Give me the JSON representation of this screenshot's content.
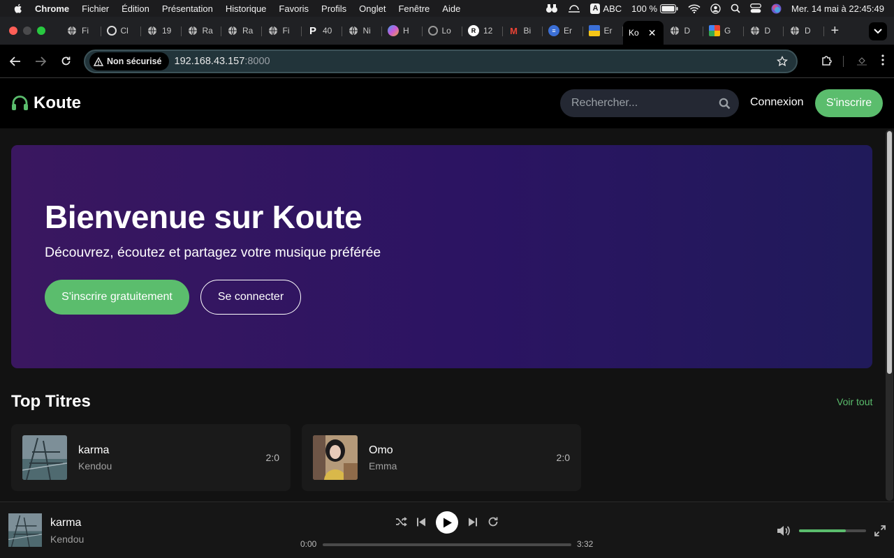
{
  "menubar": {
    "app": "Chrome",
    "items": [
      "Fichier",
      "Édition",
      "Présentation",
      "Historique",
      "Favoris",
      "Profils",
      "Onglet",
      "Fenêtre",
      "Aide"
    ],
    "input_source": "ABC",
    "battery": "100 %",
    "datetime": "Mer. 14 mai à  22:45:49"
  },
  "tabs": [
    {
      "label": "Fi",
      "icon": "globe-icon"
    },
    {
      "label": "Cl",
      "icon": "openai-icon"
    },
    {
      "label": "19",
      "icon": "globe-icon"
    },
    {
      "label": "Ra",
      "icon": "globe-icon"
    },
    {
      "label": "Ra",
      "icon": "globe-icon"
    },
    {
      "label": "Fi",
      "icon": "globe-icon"
    },
    {
      "label": "40",
      "icon": "p-icon"
    },
    {
      "label": "Ni",
      "icon": "globe-icon"
    },
    {
      "label": "H",
      "icon": "copilot-icon"
    },
    {
      "label": "Lo",
      "icon": "globe-icon"
    },
    {
      "label": "12",
      "icon": "r-icon"
    },
    {
      "label": "Bi",
      "icon": "gmail-icon"
    },
    {
      "label": "Er",
      "icon": "list-icon"
    },
    {
      "label": "Er",
      "icon": "flag-icon"
    },
    {
      "label": "Ko",
      "icon": "",
      "active": true
    },
    {
      "label": "D",
      "icon": "globe-icon"
    },
    {
      "label": "G",
      "icon": "gcloud-icon"
    },
    {
      "label": "D",
      "icon": "globe-icon"
    },
    {
      "label": "D",
      "icon": "globe-icon"
    }
  ],
  "address": {
    "security_chip": "Non sécurisé",
    "host": "192.168.43.157",
    "port": ":8000"
  },
  "site": {
    "logo": "Koute",
    "search_placeholder": "Rechercher...",
    "login": "Connexion",
    "signup": "S'inscrire"
  },
  "hero": {
    "title": "Bienvenue sur Koute",
    "subtitle": "Découvrez, écoutez et partagez votre musique préférée",
    "primary_cta": "S'inscrire gratuitement",
    "secondary_cta": "Se connecter"
  },
  "top_tracks": {
    "title": "Top Titres",
    "see_all": "Voir tout",
    "items": [
      {
        "title": "karma",
        "artist": "Kendou",
        "duration": "2:0"
      },
      {
        "title": "Omo",
        "artist": "Emma",
        "duration": "2:0"
      }
    ]
  },
  "player": {
    "title": "karma",
    "artist": "Kendou",
    "elapsed": "0:00",
    "total": "3:32",
    "progress": 0,
    "volume": 0.7
  },
  "colors": {
    "accent": "#5bbd6d",
    "hero_start": "#3a1760",
    "hero_end": "#201a5a"
  }
}
